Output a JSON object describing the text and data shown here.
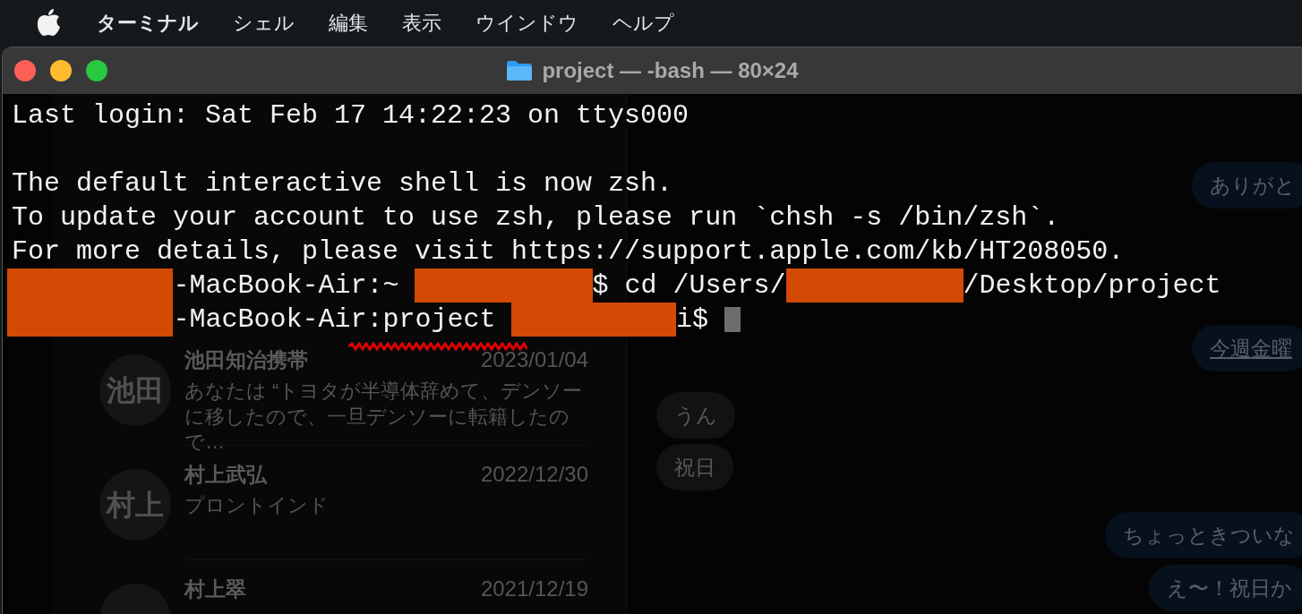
{
  "menu_bar": {
    "items": [
      {
        "label": "ターミナル",
        "kind": "app"
      },
      {
        "label": "シェル",
        "kind": "menu"
      },
      {
        "label": "編集",
        "kind": "menu"
      },
      {
        "label": "表示",
        "kind": "menu"
      },
      {
        "label": "ウインドウ",
        "kind": "menu"
      },
      {
        "label": "ヘルプ",
        "kind": "menu"
      }
    ]
  },
  "window": {
    "title": "project — -bash — 80×24"
  },
  "terminal": {
    "lines": [
      {
        "kind": "text",
        "segments": [
          {
            "kind": "text",
            "text": "Last login: Sat Feb 17 14:22:23 on ttys000"
          }
        ]
      },
      {
        "kind": "blank"
      },
      {
        "kind": "text",
        "segments": [
          {
            "kind": "text",
            "text": "The default interactive shell is now zsh."
          }
        ]
      },
      {
        "kind": "text",
        "segments": [
          {
            "kind": "text",
            "text": "To update your account to use zsh, please run `chsh -s /bin/zsh`."
          }
        ]
      },
      {
        "kind": "text",
        "segments": [
          {
            "kind": "text",
            "text": "For more details, please visit https://support.apple.com/kb/HT208050."
          }
        ]
      },
      {
        "kind": "text",
        "segments": [
          {
            "kind": "redacted"
          },
          {
            "kind": "text",
            "text": "-MacBook-Air:~ "
          },
          {
            "kind": "redacted"
          },
          {
            "kind": "text",
            "text": "$ cd /Users/"
          },
          {
            "kind": "redacted"
          },
          {
            "kind": "text",
            "text": "/Desktop/project"
          }
        ]
      },
      {
        "kind": "text",
        "segments": [
          {
            "kind": "redacted"
          },
          {
            "kind": "text",
            "text": "-MacBook-Air:project "
          },
          {
            "kind": "redacted"
          },
          {
            "kind": "text",
            "text": "i$ "
          }
        ],
        "cursor": true
      }
    ]
  },
  "background_app": {
    "chats": [
      {
        "avatar": "池田",
        "name": "池田知治携帯",
        "date": "2023/01/04",
        "preview": "あなたは “トヨタが半導体辞めて、デンソーに移したので、一旦デンソーに転籍したので…",
        "scribbled": true
      },
      {
        "avatar": "村上",
        "name": "村上武弘",
        "date": "2022/12/30",
        "preview": "プロントインド",
        "scribbled": false
      },
      {
        "name": "村上翠",
        "date": "2021/12/19",
        "scribbled": false
      }
    ],
    "bubbles": [
      {
        "text": "ありがと",
        "kind": "outgoing",
        "underlined": false
      },
      {
        "text": "今週金曜",
        "kind": "outgoing",
        "underlined": true
      },
      {
        "text": "うん",
        "kind": "incoming",
        "underlined": false
      },
      {
        "text": "祝日",
        "kind": "incoming",
        "underlined": false
      },
      {
        "text": "ちょっときついな",
        "kind": "outgoing",
        "underlined": false
      },
      {
        "text": "え〜！祝日か",
        "kind": "outgoing",
        "underlined": false
      }
    ]
  }
}
